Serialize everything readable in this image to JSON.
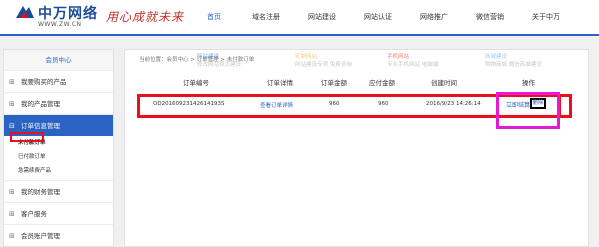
{
  "header": {
    "logo_name": "中万网络",
    "logo_url": "WWW.ZW.CN",
    "slogan": "用心成就未来",
    "nav": [
      {
        "label": "首页",
        "active": true
      },
      {
        "label": "域名注册",
        "active": false
      },
      {
        "label": "网站建设",
        "active": false
      },
      {
        "label": "网站认证",
        "active": false
      },
      {
        "label": "网络推广",
        "active": false
      },
      {
        "label": "微信营销",
        "active": false
      },
      {
        "label": "关于中万",
        "active": false
      }
    ]
  },
  "sidebar": {
    "title": "会员中心",
    "items": [
      {
        "label": "我要购买的产品"
      },
      {
        "label": "我的产品管理"
      },
      {
        "label": "订单信息管理",
        "active": true
      }
    ],
    "subitems": [
      {
        "label": "未付款订单",
        "current": true
      },
      {
        "label": "已付款订单"
      },
      {
        "label": "急需续费产品"
      }
    ],
    "items_after": [
      {
        "label": "我的财务管理"
      },
      {
        "label": "客户服务"
      },
      {
        "label": "会员账户管理"
      }
    ]
  },
  "main": {
    "breadcrumb": "当前位置：会员中心 > 订单管理 > 未付款订单",
    "ghost_tabs": [
      {
        "top": "网站建设",
        "bottom": "修改网站首页建设"
      },
      {
        "top": "定制网站",
        "bottom": "网站建设专项 免费咨询"
      },
      {
        "top": "手机网站",
        "bottom": "专业手机网站 电脑端"
      },
      {
        "top": "商城建设",
        "bottom": "购物商城 微信商城建设"
      }
    ],
    "table": {
      "headers": [
        "订单编号",
        "订单详情",
        "订单金额",
        "应付金额",
        "创建时间",
        "操作"
      ],
      "rows": [
        {
          "order_no": "OD20160923142614193S",
          "details_link": "查看订单详情",
          "amount": "960",
          "payable": "960",
          "created": "2016/9/23 14:26:14",
          "pay_label": "立即结算",
          "delete_label": "删除"
        }
      ]
    }
  },
  "colors": {
    "brand_blue": "#2a63c4",
    "highlight_red": "#e8101a",
    "highlight_pink": "#e619d7"
  }
}
